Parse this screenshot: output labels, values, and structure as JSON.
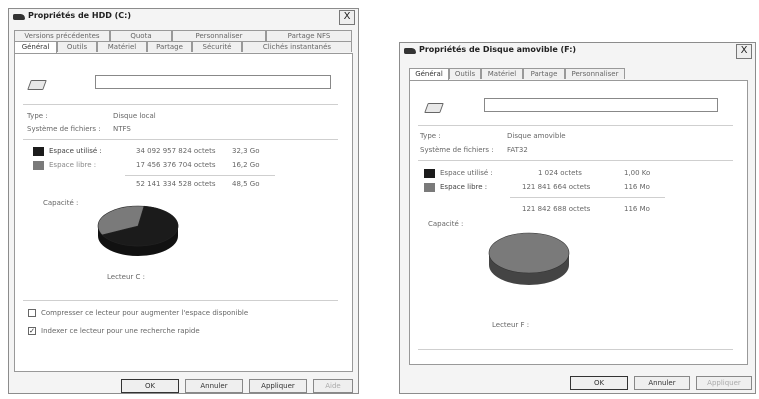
{
  "colors": {
    "used": "#1b1b1b",
    "free": "#7a7a7a",
    "used_slice": "#7a7a7a"
  },
  "left": {
    "title": "Propriétés de HDD (C:)",
    "close": "X",
    "tabs_row1": [
      "Versions précédentes",
      "Quota",
      "Personnaliser",
      "Partage NFS"
    ],
    "tabs_row2": [
      "Général",
      "Outils",
      "Matériel",
      "Partage",
      "Sécurité",
      "Clichés instantanés"
    ],
    "type_label": "Type :",
    "type_value": "Disque local",
    "fs_label": "Système de fichiers :",
    "fs_value": "NTFS",
    "used_label": "Espace utilisé :",
    "used_bytes": "34 092 957 824 octets",
    "used_size": "32,3 Go",
    "free_label": "Espace libre :",
    "free_bytes": "17 456 376 704 octets",
    "free_size": "16,2 Go",
    "capacity_label": "Capacité :",
    "capacity_bytes": "52 141 334 528 octets",
    "capacity_size": "48,5 Go",
    "drive_label": "Lecteur C :",
    "used_fraction": 0.653,
    "compress_label": "Compresser ce lecteur pour augmenter l'espace disponible",
    "compress_checked": false,
    "index_label": "Indexer ce lecteur pour une recherche rapide",
    "index_checked": true,
    "check_mark": "✓",
    "ok": "OK",
    "cancel": "Annuler",
    "apply": "Appliquer",
    "help": "Aide"
  },
  "right": {
    "title": "Propriétés de Disque amovible (F:)",
    "close": "X",
    "tabs": [
      "Général",
      "Outils",
      "Matériel",
      "Partage",
      "Personnaliser"
    ],
    "type_label": "Type :",
    "type_value": "Disque amovible",
    "fs_label": "Système de fichiers :",
    "fs_value": "FAT32",
    "used_label": "Espace utilisé :",
    "used_bytes": "1 024 octets",
    "used_size": "1,00 Ko",
    "free_label": "Espace libre :",
    "free_bytes": "121 841 664 octets",
    "free_size": "116 Mo",
    "capacity_label": "Capacité :",
    "capacity_bytes": "121 842 688 octets",
    "capacity_size": "116 Mo",
    "drive_label": "Lecteur F :",
    "used_fraction": 0.0,
    "ok": "OK",
    "cancel": "Annuler",
    "apply": "Appliquer"
  }
}
